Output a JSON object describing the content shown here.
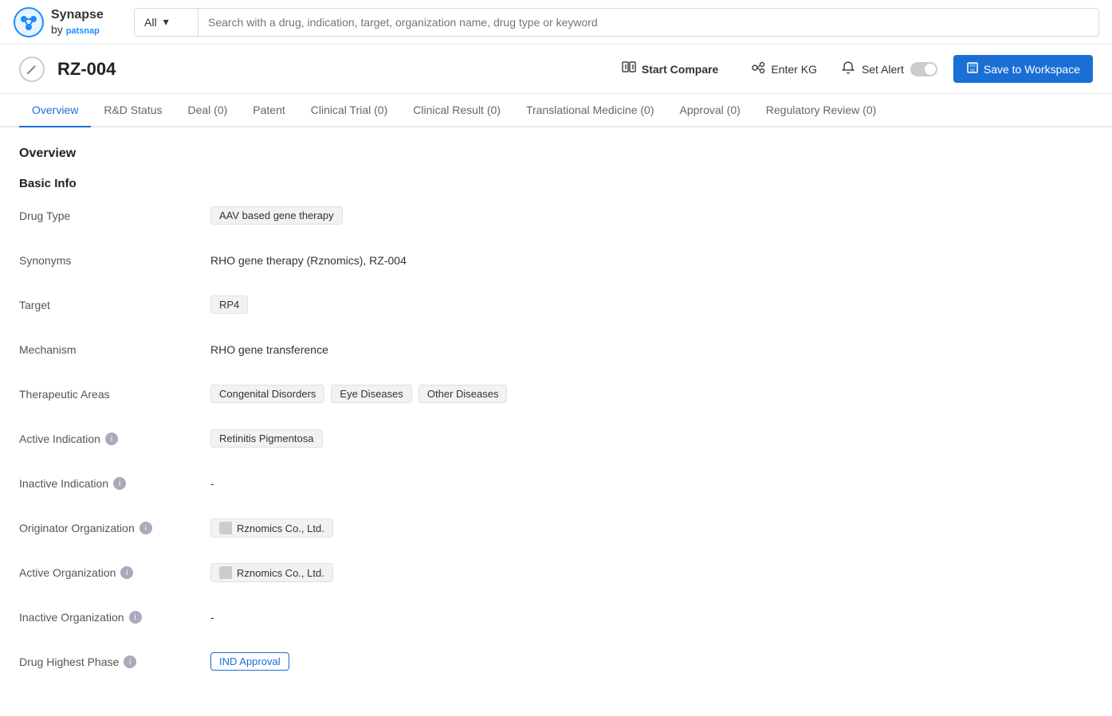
{
  "logo": {
    "synapse": "Synapse",
    "by": "by",
    "patsnap": "patsnap"
  },
  "search": {
    "dropdown_label": "All",
    "placeholder": "Search with a drug, indication, target, organization name, drug type or keyword"
  },
  "drug": {
    "name": "RZ-004",
    "icon": "✏"
  },
  "actions": {
    "start_compare": "Start Compare",
    "enter_kg": "Enter KG",
    "set_alert": "Set Alert",
    "save_to_workspace": "Save to Workspace"
  },
  "tabs": [
    {
      "label": "Overview",
      "active": true,
      "count": null
    },
    {
      "label": "R&D Status",
      "active": false,
      "count": null
    },
    {
      "label": "Deal (0)",
      "active": false,
      "count": 0
    },
    {
      "label": "Patent",
      "active": false,
      "count": null
    },
    {
      "label": "Clinical Trial (0)",
      "active": false,
      "count": 0
    },
    {
      "label": "Clinical Result (0)",
      "active": false,
      "count": 0
    },
    {
      "label": "Translational Medicine (0)",
      "active": false,
      "count": 0
    },
    {
      "label": "Approval (0)",
      "active": false,
      "count": 0
    },
    {
      "label": "Regulatory Review (0)",
      "active": false,
      "count": 0
    }
  ],
  "overview": {
    "section_title": "Overview",
    "basic_info_title": "Basic Info",
    "fields": [
      {
        "id": "drug-type",
        "label": "Drug Type",
        "has_info": false,
        "type": "tags",
        "values": [
          "AAV based gene therapy"
        ]
      },
      {
        "id": "synonyms",
        "label": "Synonyms",
        "has_info": false,
        "type": "plain",
        "values": [
          "RHO gene therapy (Rznomics),  RZ-004"
        ]
      },
      {
        "id": "target",
        "label": "Target",
        "has_info": false,
        "type": "tags",
        "values": [
          "RP4"
        ]
      },
      {
        "id": "mechanism",
        "label": "Mechanism",
        "has_info": false,
        "type": "plain",
        "values": [
          "RHO gene transference"
        ]
      },
      {
        "id": "therapeutic-areas",
        "label": "Therapeutic Areas",
        "has_info": false,
        "type": "tags",
        "values": [
          "Congenital Disorders",
          "Eye Diseases",
          "Other Diseases"
        ]
      },
      {
        "id": "active-indication",
        "label": "Active Indication",
        "has_info": true,
        "type": "tags",
        "values": [
          "Retinitis Pigmentosa"
        ]
      },
      {
        "id": "inactive-indication",
        "label": "Inactive Indication",
        "has_info": true,
        "type": "dash",
        "values": [
          "-"
        ]
      },
      {
        "id": "originator-organization",
        "label": "Originator Organization",
        "has_info": true,
        "type": "org",
        "values": [
          "Rznomics Co., Ltd."
        ]
      },
      {
        "id": "active-organization",
        "label": "Active Organization",
        "has_info": true,
        "type": "org",
        "values": [
          "Rznomics Co., Ltd."
        ]
      },
      {
        "id": "inactive-organization",
        "label": "Inactive Organization",
        "has_info": true,
        "type": "dash",
        "values": [
          "-"
        ]
      },
      {
        "id": "drug-highest-phase",
        "label": "Drug Highest Phase",
        "has_info": true,
        "type": "tag-blue",
        "values": [
          "IND Approval"
        ]
      }
    ]
  }
}
